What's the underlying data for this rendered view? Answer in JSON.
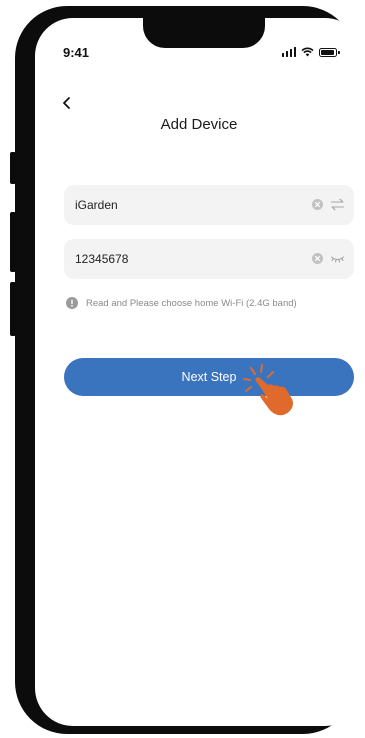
{
  "status": {
    "time": "9:41"
  },
  "header": {
    "title": "Add Device"
  },
  "form": {
    "ssid_value": "iGarden",
    "password_value": "12345678"
  },
  "hint": {
    "text": "Read and Please choose home Wi-Fi (2.4G band)"
  },
  "actions": {
    "next_label": "Next Step"
  },
  "colors": {
    "primary": "#3b74be",
    "pointer": "#e06a2b"
  },
  "icons": {
    "back": "chevron-left-icon",
    "clear": "clear-circle-icon",
    "swap": "swap-arrows-icon",
    "password_toggle": "eye-closed-icon",
    "info": "info-circle-icon",
    "pointer": "tap-hand-icon"
  }
}
